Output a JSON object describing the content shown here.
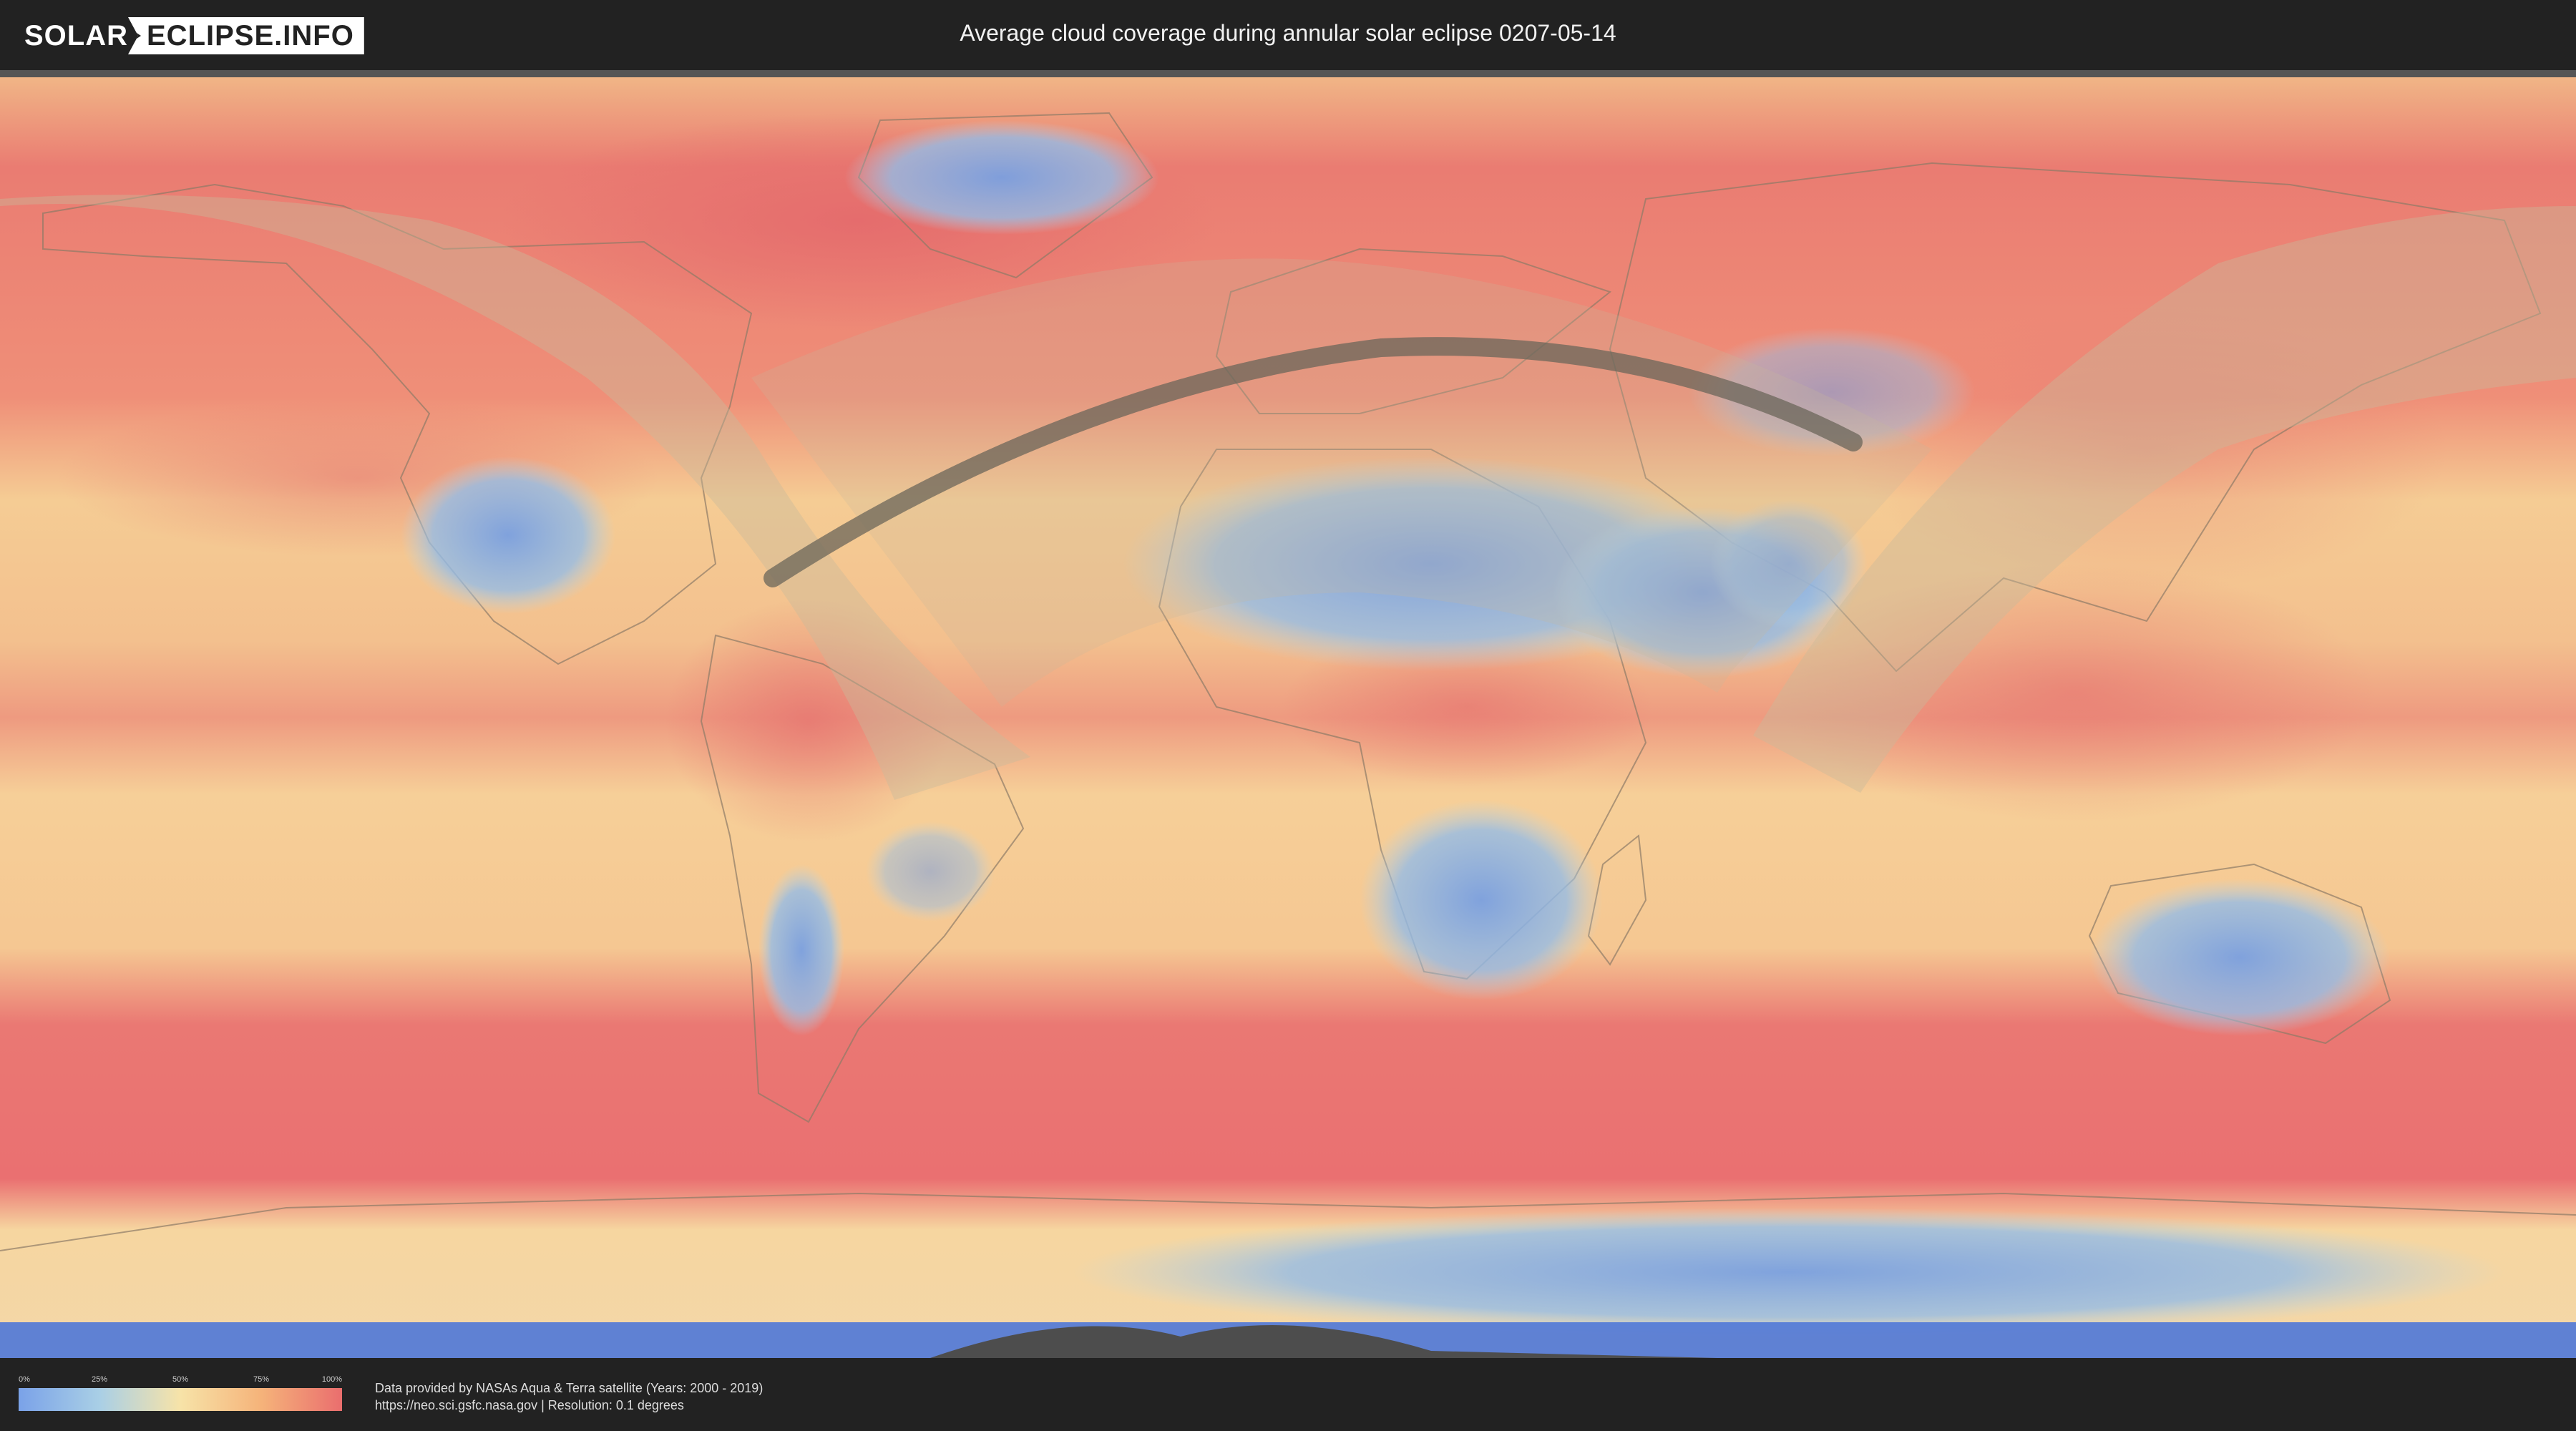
{
  "header": {
    "logo_left": "SOLAR",
    "logo_right": "ECLIPSE.INFO",
    "title": "Average cloud coverage during annular solar eclipse 0207-05-14"
  },
  "legend": {
    "ticks": [
      "0%",
      "25%",
      "50%",
      "75%",
      "100%"
    ],
    "colors": [
      "#7aa2e8",
      "#a9cfe6",
      "#f7e3a8",
      "#f5b37a",
      "#ea6e6e"
    ]
  },
  "footer": {
    "credit_line1": "Data provided by NASAs Aqua & Terra satellite (Years: 2000 - 2019)",
    "credit_line2": "https://neo.sci.gsfc.nasa.gov | Resolution: 0.1 degrees"
  },
  "map": {
    "ocean_color": "#f4c58c",
    "cloudy_color": "#ea7470",
    "clear_color": "#7fa6e0",
    "penumbra_color": "#c7b99a",
    "path_color": "#6b655a"
  }
}
